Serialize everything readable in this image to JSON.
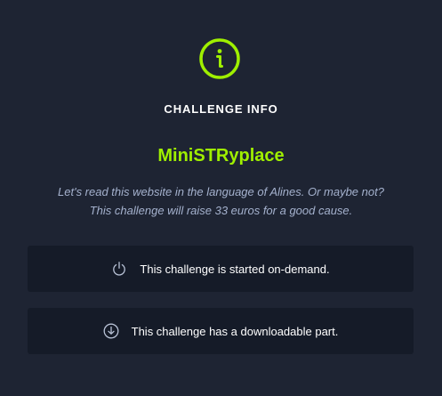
{
  "icon": "info-icon",
  "accent_color": "#9fef00",
  "heading": "CHALLENGE INFO",
  "challenge_name": "MiniSTRyplace",
  "description_lines": [
    "Let's read this website in the language of Alines. Or maybe not?",
    "This challenge will raise 33 euros for a good cause."
  ],
  "features": [
    {
      "icon": "power-icon",
      "text": "This challenge is started on-demand."
    },
    {
      "icon": "download-icon",
      "text": "This challenge has a downloadable part."
    }
  ]
}
